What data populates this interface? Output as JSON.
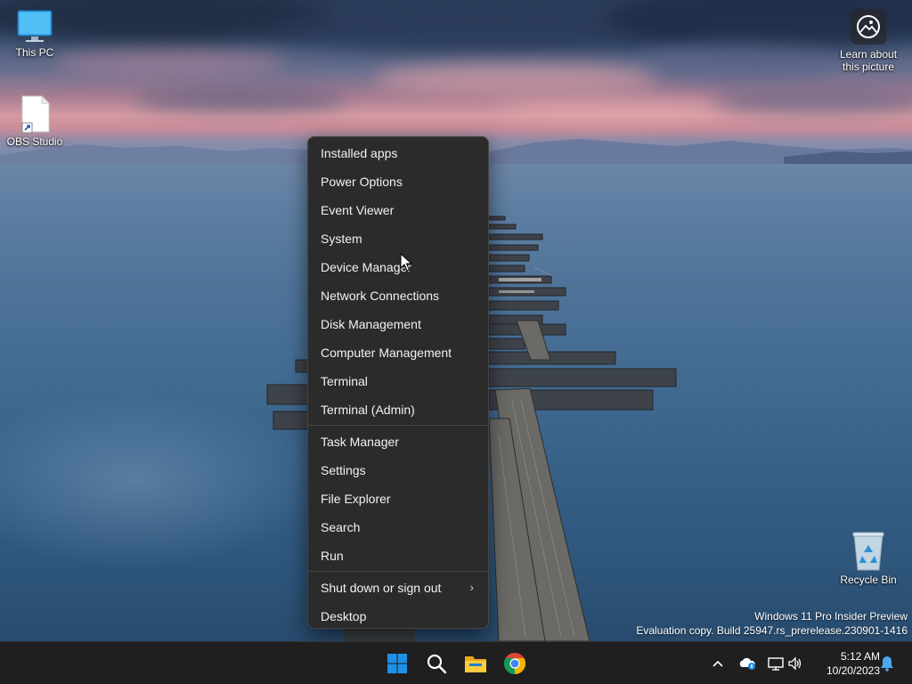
{
  "desktop": {
    "icons": [
      {
        "label": "This PC"
      },
      {
        "label": "OBS Studio"
      },
      {
        "label": "Recycle Bin"
      }
    ],
    "spotlight": {
      "line1": "Learn about",
      "line2": "this picture"
    },
    "watermark": {
      "line1": "Windows 11 Pro Insider Preview",
      "line2": "Evaluation copy. Build 25947.rs_prerelease.230901-1416"
    }
  },
  "context_menu": {
    "groups": [
      [
        "Installed apps",
        "Power Options",
        "Event Viewer",
        "System",
        "Device Manager",
        "Network Connections",
        "Disk Management",
        "Computer Management",
        "Terminal",
        "Terminal (Admin)"
      ],
      [
        "Task Manager",
        "Settings",
        "File Explorer",
        "Search",
        "Run"
      ],
      [
        "Shut down or sign out",
        "Desktop"
      ]
    ],
    "submenu_chevron": "›"
  },
  "taskbar": {
    "pinned": [
      {
        "icon": "windows-start-icon"
      },
      {
        "icon": "search-icon"
      },
      {
        "icon": "file-explorer-icon"
      },
      {
        "icon": "chrome-icon"
      }
    ],
    "tray": {
      "icons": [
        "chevron-up-icon",
        "onedrive-icon",
        "network-icon",
        "volume-icon",
        "notification-bell-icon"
      ]
    },
    "clock": {
      "time": "5:12 AM",
      "date": "10/20/2023"
    }
  },
  "colors": {
    "menu_bg": "#2b2b2b",
    "taskbar_bg": "#1f1f1f",
    "windows_blue": "#1e90e6"
  }
}
